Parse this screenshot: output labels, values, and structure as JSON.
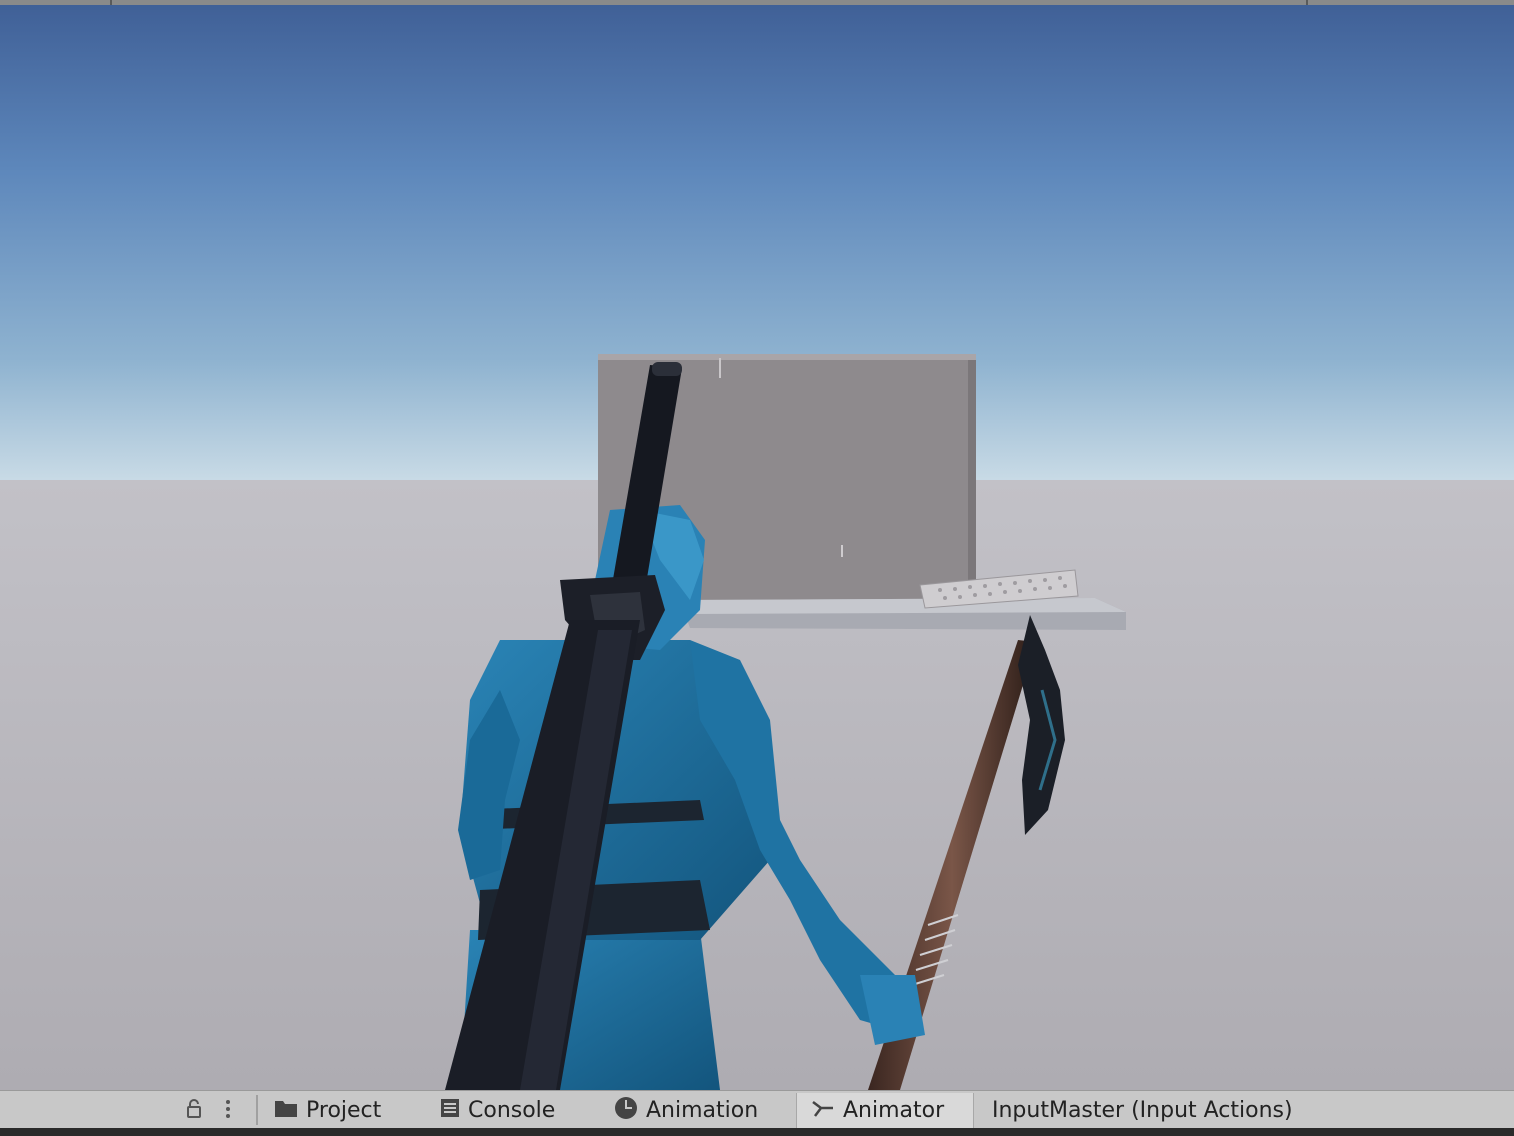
{
  "toolbar": {
    "lock_icon": "lock-icon",
    "menu_icon": "vertical-ellipsis-icon"
  },
  "tabs": [
    {
      "label": "Project",
      "icon": "folder-icon"
    },
    {
      "label": "Console",
      "icon": "console-list-icon"
    },
    {
      "label": "Animation",
      "icon": "clock-icon"
    },
    {
      "label": "Animator",
      "icon": "animator-graph-icon",
      "active": true
    }
  ],
  "document_title": "InputMaster (Input Actions)",
  "colors": {
    "sky_top": "#3f5f96",
    "sky_horizon": "#c9dbe6",
    "ground": "#b5b3b8",
    "character": "#1e6f9c",
    "sword": "#1a1d26",
    "tab_bar": "#c8c8c8"
  }
}
